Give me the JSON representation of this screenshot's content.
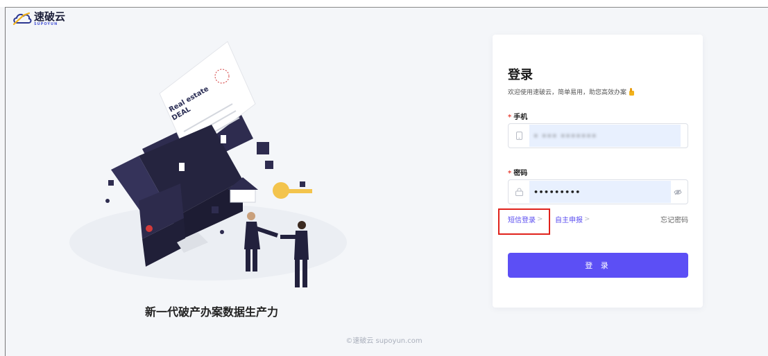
{
  "brand": {
    "name_cn": "速破云",
    "name_en": "SUPOYUN",
    "logo_icon": "cloud-logo-icon"
  },
  "hero": {
    "document_title": "Real estate\nDEAL",
    "slogan": "新一代破产办案数据生产力"
  },
  "login": {
    "title": "登录",
    "subtitle": "欢迎使用速破云，简单易用，助您高效办案",
    "subtitle_icon": "thumbs-up-icon",
    "phone": {
      "label": "手机",
      "required_mark": "*",
      "value": "• ••• •••••••",
      "icon": "mobile-phone-icon"
    },
    "password": {
      "label": "密码",
      "required_mark": "*",
      "value": "•••••••••",
      "icon": "lock-icon",
      "toggle_icon": "eye-hidden-icon"
    },
    "links": {
      "sms_login": "短信登录",
      "self_declare": "自主申报",
      "forgot_password": "忘记密码",
      "chevron": ">"
    },
    "submit_label": "登 录"
  },
  "footer": {
    "copyright": "©速破云 supoyun.com"
  },
  "colors": {
    "accent": "#5c4ff5",
    "background": "#f4f6f9",
    "highlight_box": "#e0211b",
    "required": "#e8473b",
    "autofill": "#e8f0fe"
  }
}
